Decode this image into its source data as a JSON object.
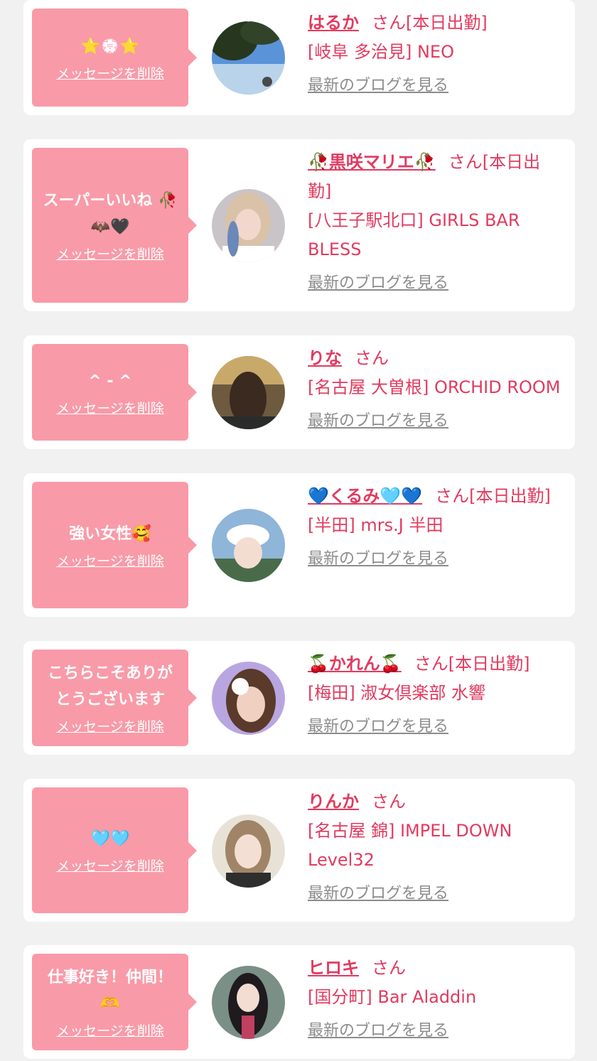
{
  "delete_label": "メッセージを削除",
  "blog_label": "最新のブログを見る",
  "san_label": "さん",
  "colors": {
    "accent": "#e23a5f",
    "bubble": "#f99aa8",
    "link_gray": "#8c8c8c",
    "background": "#f1f1f1"
  },
  "cards": [
    {
      "message": "⭐💮⭐",
      "name": "はるか",
      "status": "[本日出勤]",
      "shop": "[岐阜 多治見] NEO"
    },
    {
      "message": "スーパーいいね 🥀🦇🖤",
      "name": "🥀黒咲マリエ🥀",
      "status": "[本日出勤]",
      "shop": "[八王子駅北口] GIRLS BAR BLESS"
    },
    {
      "message": "^ - ^",
      "name": "りな",
      "status": "",
      "shop": "[名古屋 大曽根] ORCHID ROOM"
    },
    {
      "message": "強い女性🥰",
      "name": "💙くるみ🩵💙",
      "status": "[本日出勤]",
      "shop": "[半田] mrs.J 半田"
    },
    {
      "message": "こちらこそありがとうございます",
      "name": "🍒かれん🍒",
      "status": "[本日出勤]",
      "shop": "[梅田] 淑女倶楽部 水響"
    },
    {
      "message": "🩵🩵",
      "name": "りんか",
      "status": "",
      "shop": "[名古屋 錦] IMPEL DOWN Level32"
    },
    {
      "message": "仕事好き！仲間！🫶",
      "name": "ヒロキ",
      "status": "",
      "shop": "[国分町] Bar Aladdin"
    }
  ]
}
